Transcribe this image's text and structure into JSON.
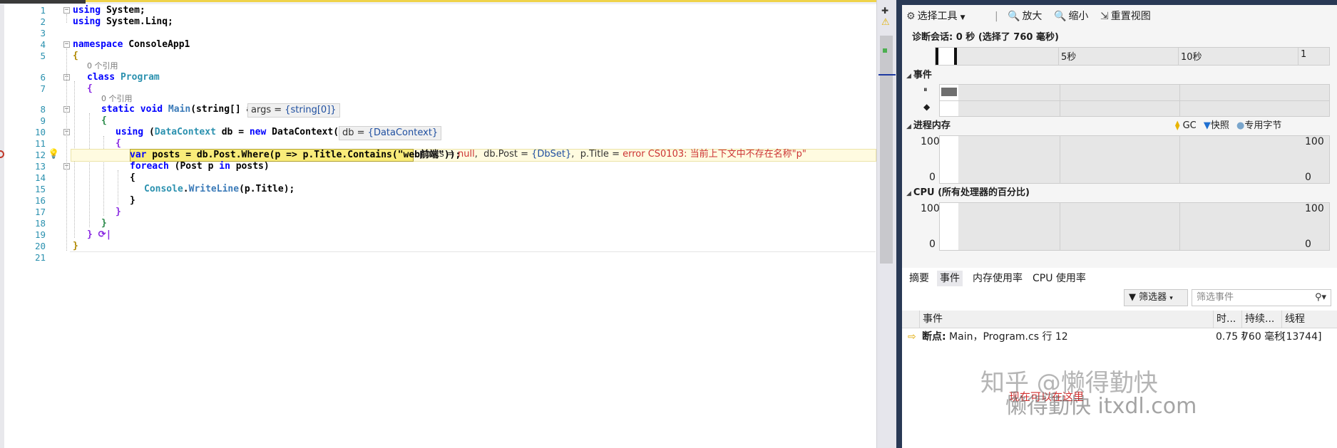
{
  "editor": {
    "line_numbers": [
      "1",
      "2",
      "3",
      "4",
      "5",
      "6",
      "7",
      "8",
      "9",
      "10",
      "11",
      "12",
      "13",
      "14",
      "15",
      "16",
      "17",
      "18",
      "19",
      "20",
      "21"
    ],
    "code": {
      "l1_kw": "using",
      "l1_rest": " System;",
      "l2_kw": "using",
      "l2_rest": " System.Linq;",
      "l4_kw": "namespace",
      "l4_rest": " ConsoleApp1",
      "l5": "{",
      "l6_kw": "class",
      "l6_type": " Program",
      "l7": "{",
      "l8_kw": "static void",
      "l8_method": " Main",
      "l8_rest": "(string[] args)",
      "l9": "{",
      "l10_kw": "using",
      "l10_a": " (",
      "l10_type": "DataContext",
      "l10_b": " db = ",
      "l10_kw2": "new",
      "l10_c": " DataContext())",
      "l11": "{",
      "l12_kw": "var",
      "l12_a": " posts = db.Post.Where(p => p.Title.Contains(",
      "l12_str": "\"web前端\"",
      "l12_b": "));",
      "l13_kw": "foreach",
      "l13_a": " (Post p ",
      "l13_kw2": "in",
      "l13_b": " posts)",
      "l14": "{",
      "l15_type": "Console",
      "l15_a": ".",
      "l15_method": "WriteLine",
      "l15_b": "(p.Title);",
      "l16": "}",
      "l17": "}",
      "l18": "}",
      "l19": "} ⟳|",
      "l20": "}"
    },
    "references": [
      "0 个引用",
      "0 个引用"
    ],
    "datatips": {
      "args_label": "args = ",
      "args_val": "{string[0]}",
      "db_label": "db = ",
      "db_val": "{DataContext}",
      "posts_label": "posts = ",
      "posts_val": "null",
      "dbpost_label": "db.Post = ",
      "dbpost_val": "{DbSet}",
      "ptitle_label": "p.Title = ",
      "ptitle_val": "error CS0103: 当前上下文中不存在名称\"p\""
    }
  },
  "diagnostics": {
    "toolbar": {
      "select_tool": "选择工具",
      "zoom_in": "放大",
      "zoom_out": "缩小",
      "reset_view": "重置视图"
    },
    "session": "诊断会话: 0 秒 (选择了 760 毫秒)",
    "timeline_ticks": [
      "5秒",
      "10秒",
      "1"
    ],
    "events_section": "事件",
    "memory_section": "进程内存",
    "memory_legend": {
      "gc": "GC",
      "snapshot": "快照",
      "private_bytes": "专用字节"
    },
    "memory_axis": {
      "top": "100",
      "bottom": "0"
    },
    "cpu_section": "CPU (所有处理器的百分比)",
    "cpu_axis": {
      "top": "100",
      "bottom": "0"
    },
    "tabs": [
      "摘要",
      "事件",
      "内存使用率",
      "CPU 使用率"
    ],
    "filter_button": "筛选器",
    "filter_placeholder": "筛选事件",
    "columns": [
      "事件",
      "时...",
      "持续...",
      "线程"
    ],
    "row": {
      "event_bold": "断点:",
      "event_rest": " Main，Program.cs 行 12",
      "time": "0.75 秒",
      "duration": "760 毫秒",
      "thread": "[13744]"
    },
    "red_text": "现在可以在这里",
    "watermark_1": "知乎 @懒得勤快",
    "watermark_2": "懒得勤快  itxdl.com"
  },
  "colors": {
    "accent_splitter": "#293955",
    "breakpoint": "#c0392b",
    "current_statement": "#f9ec7a"
  }
}
